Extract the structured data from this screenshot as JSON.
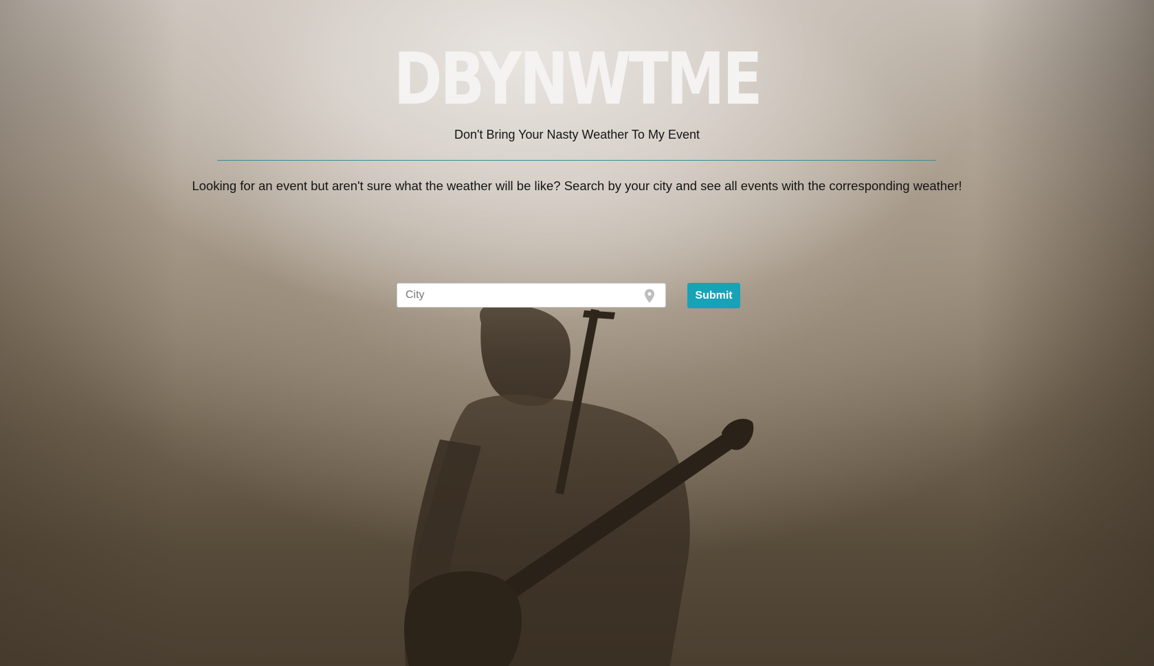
{
  "header": {
    "title": "DBYNWTME",
    "tagline": "Don't Bring Your Nasty Weather To My Event"
  },
  "intro": {
    "text": "Looking for an event but aren't sure what the weather will be like? Search by your city and see all events with the corresponding weather!"
  },
  "search": {
    "placeholder": "City",
    "value": "",
    "location_icon": "map-pin-icon",
    "submit_label": "Submit"
  },
  "colors": {
    "accent": "#17a2b8",
    "divider": "#3a8a9a",
    "title": "#f4f3f2",
    "text": "#141414"
  },
  "background": {
    "image": "musician-with-guitar-silhouette"
  }
}
